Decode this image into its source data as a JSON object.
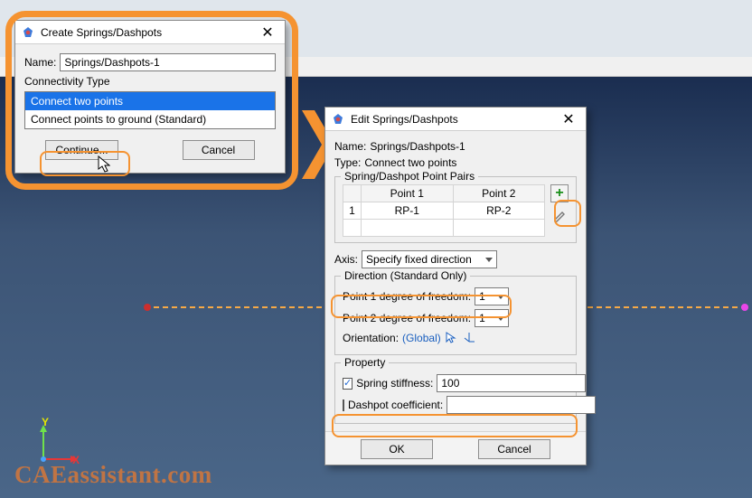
{
  "watermark": "CAEassistant.com",
  "triad": {
    "x": "X",
    "y": "Y"
  },
  "dialog1": {
    "title": "Create Springs/Dashpots",
    "name_label": "Name:",
    "name_value": "Springs/Dashpots-1",
    "connectivity_label": "Connectivity Type",
    "options": [
      "Connect two points",
      "Connect points to ground (Standard)"
    ],
    "continue_btn": "Continue...",
    "cancel_btn": "Cancel"
  },
  "dialog2": {
    "title": "Edit Springs/Dashpots",
    "name_label": "Name:",
    "name_value": "Springs/Dashpots-1",
    "type_label": "Type:",
    "type_value": "Connect two points",
    "pairs_legend": "Spring/Dashpot Point Pairs",
    "col_row": "",
    "col_p1": "Point 1",
    "col_p2": "Point 2",
    "row_idx": "1",
    "row_p1": "RP-1",
    "row_p2": "RP-2",
    "axis_label": "Axis:",
    "axis_value": "Specify fixed direction",
    "dir_legend": "Direction (Standard Only)",
    "dof1_label": "Point 1 degree of freedom:",
    "dof1_value": "1",
    "dof2_label": "Point 2 degree of freedom:",
    "dof2_value": "1",
    "orient_label": "Orientation:",
    "orient_value": "(Global)",
    "prop_legend": "Property",
    "stiff_label": "Spring stiffness:",
    "stiff_value": "100",
    "dash_label": "Dashpot coefficient:",
    "dash_value": "",
    "ok_btn": "OK",
    "cancel_btn": "Cancel"
  }
}
